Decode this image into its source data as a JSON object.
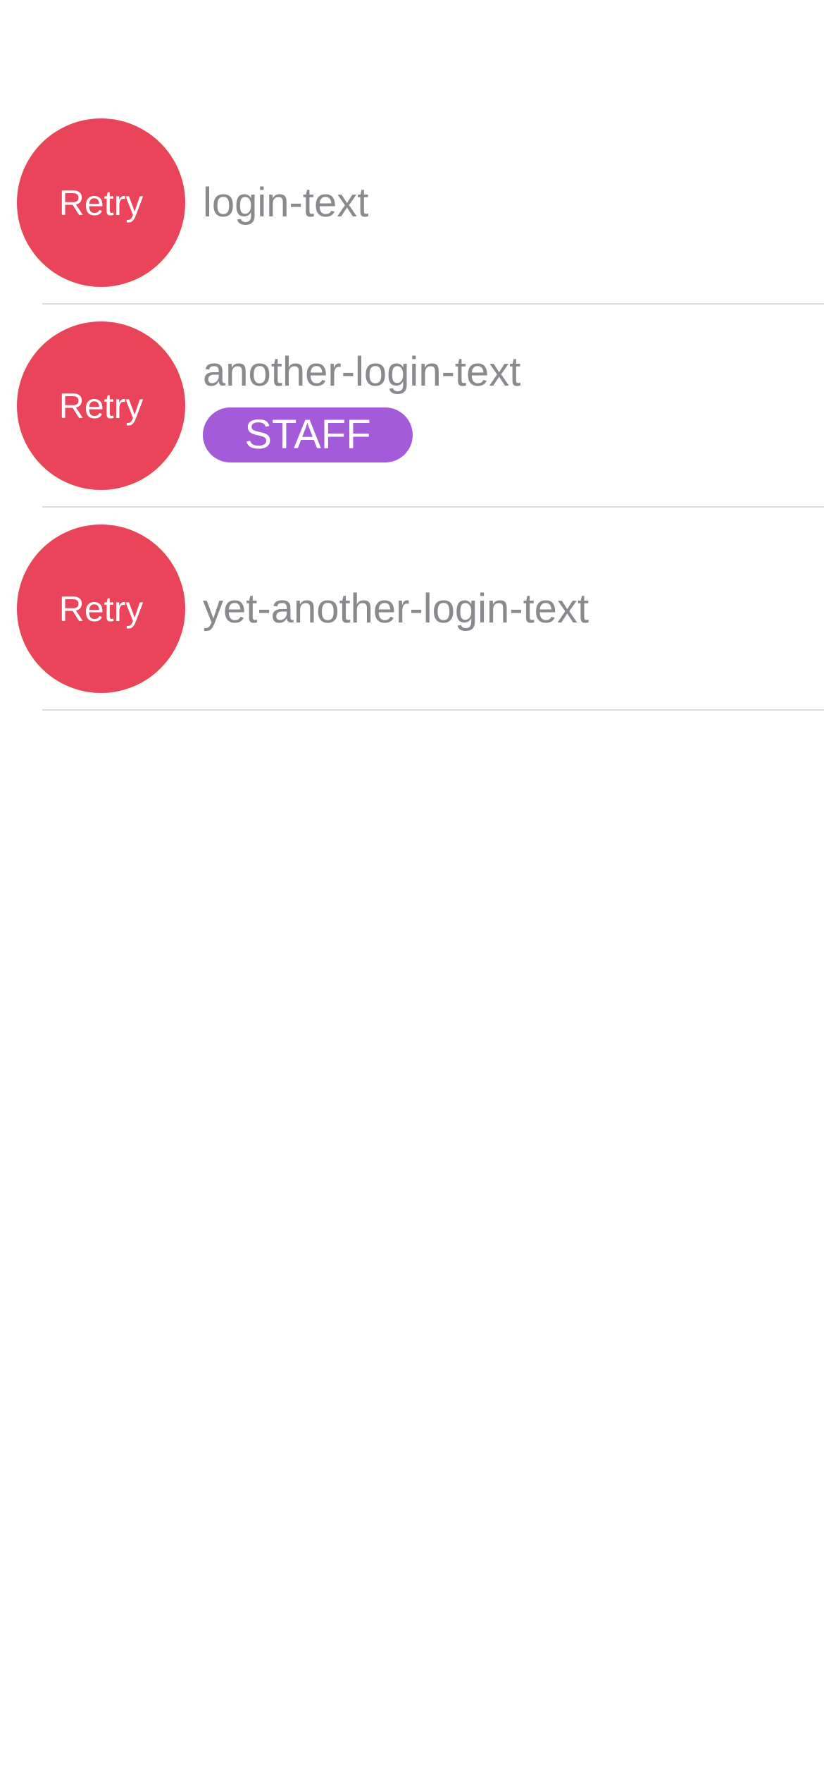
{
  "accounts": [
    {
      "retry_label": "Retry",
      "login": "login-text"
    },
    {
      "retry_label": "Retry",
      "login": "another-login-text",
      "badge": "STAFF"
    },
    {
      "retry_label": "Retry",
      "login": "yet-another-login-text"
    }
  ],
  "colors": {
    "retry_button": "#e9445a",
    "staff_badge": "#a45bd9",
    "login_text": "#8a8a8e",
    "separator": "#dcdcdf"
  }
}
